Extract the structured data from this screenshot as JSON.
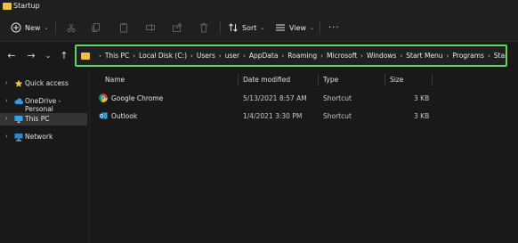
{
  "window": {
    "title": "Startup"
  },
  "toolbar": {
    "new_label": "New",
    "sort_label": "Sort",
    "view_label": "View",
    "more_label": "···"
  },
  "address": {
    "crumbs": [
      "This PC",
      "Local Disk (C:)",
      "Users",
      "user",
      "AppData",
      "Roaming",
      "Microsoft",
      "Windows",
      "Start Menu",
      "Programs",
      "Startup"
    ],
    "highlight_color": "#5fd35f"
  },
  "sidebar": {
    "items": [
      {
        "label": "Quick access",
        "icon": "star-icon"
      },
      {
        "label": "OneDrive - Personal",
        "icon": "cloud-icon"
      },
      {
        "label": "This PC",
        "icon": "computer-icon",
        "selected": true
      },
      {
        "label": "Network",
        "icon": "network-icon"
      }
    ]
  },
  "table": {
    "headers": {
      "name": "Name",
      "date": "Date modified",
      "type": "Type",
      "size": "Size"
    },
    "rows": [
      {
        "name": "Google Chrome",
        "date": "5/13/2021 8:57 AM",
        "type": "Shortcut",
        "size": "3 KB",
        "icon": "chrome-icon"
      },
      {
        "name": "Outlook",
        "date": "1/4/2021 3:30 PM",
        "type": "Shortcut",
        "size": "3 KB",
        "icon": "outlook-icon"
      }
    ]
  }
}
